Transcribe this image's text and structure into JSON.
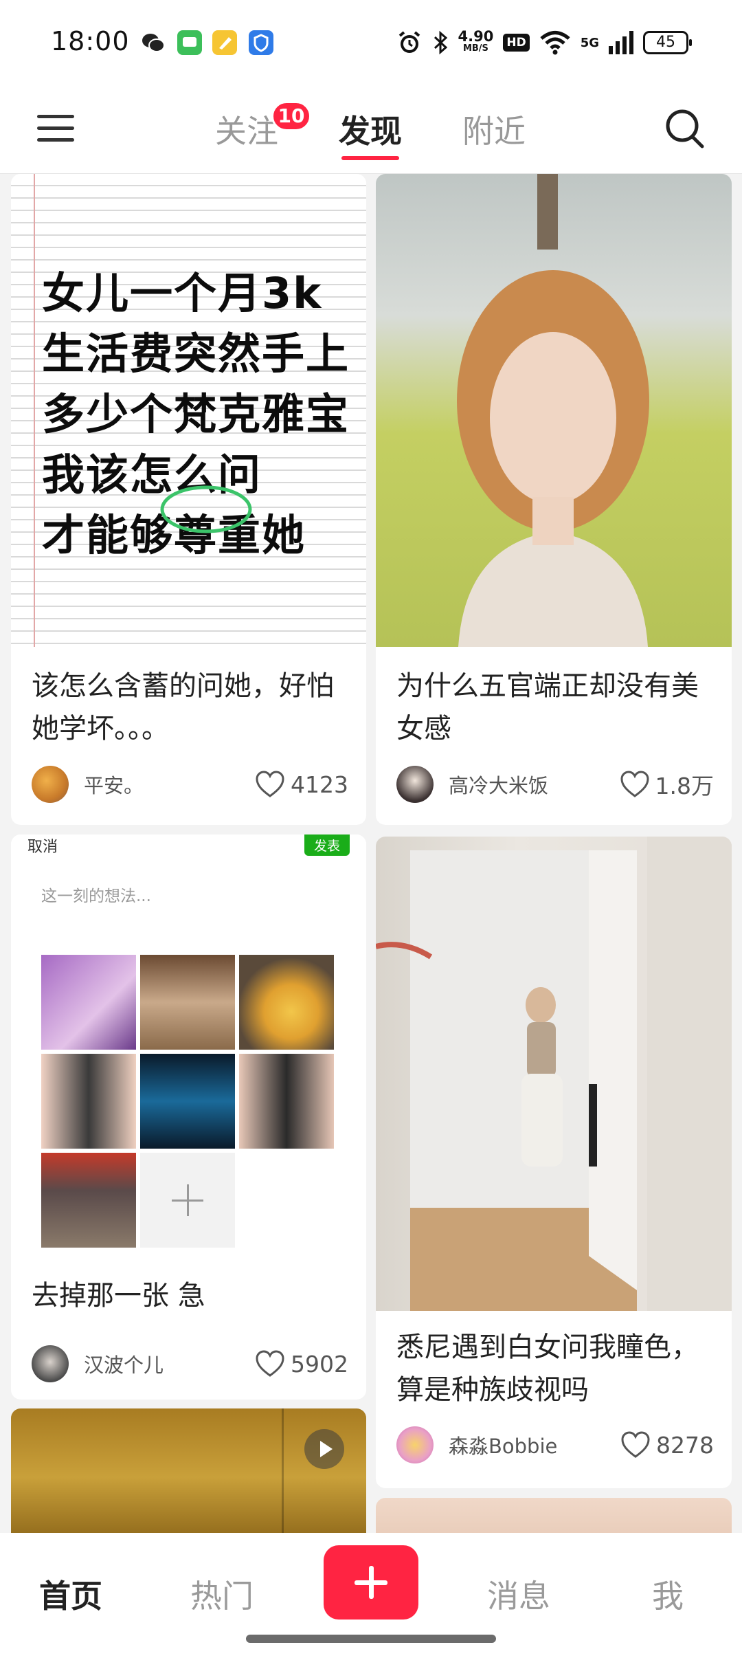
{
  "status_bar": {
    "time": "18:00",
    "net_speed_value": "4.90",
    "net_speed_unit": "MB/S",
    "hd_label": "HD",
    "network_label": "5G",
    "battery": "45",
    "icons": [
      "wechat-icon",
      "messages-icon",
      "notes-icon",
      "shield-icon",
      "alarm-icon",
      "bluetooth-icon",
      "wifi-icon",
      "signal-icon",
      "battery-icon"
    ]
  },
  "top_nav": {
    "tabs": [
      {
        "label": "关注",
        "badge": "10"
      },
      {
        "label": "发现",
        "active": true
      },
      {
        "label": "附近"
      }
    ],
    "accent_color": "#ff2442"
  },
  "feed": {
    "cards": [
      {
        "image_text": [
          "女儿一个月3k",
          "生活费突然手上",
          "多少个梵克雅宝",
          "我该怎么问",
          "才能够尊重她"
        ],
        "title": "该怎么含蓄的问她，好怕她学坏。。。",
        "author": "平安。",
        "likes": "4123"
      },
      {
        "title": "为什么五官端正却没有美女感",
        "author": "高冷大米饭",
        "likes": "1.8万"
      },
      {
        "image": {
          "cancel": "取消",
          "post": "发表",
          "placeholder": "这一刻的想法..."
        },
        "title": "去掉那一张 急",
        "author": "汉波个儿",
        "likes": "5902"
      },
      {
        "title": "悉尼遇到白女问我瞳色，算是种族歧视吗",
        "author": "森淼Bobbie",
        "likes": "8278"
      }
    ]
  },
  "bottom_nav": {
    "items": [
      "首页",
      "热门",
      "消息",
      "我"
    ],
    "active": "首页"
  }
}
